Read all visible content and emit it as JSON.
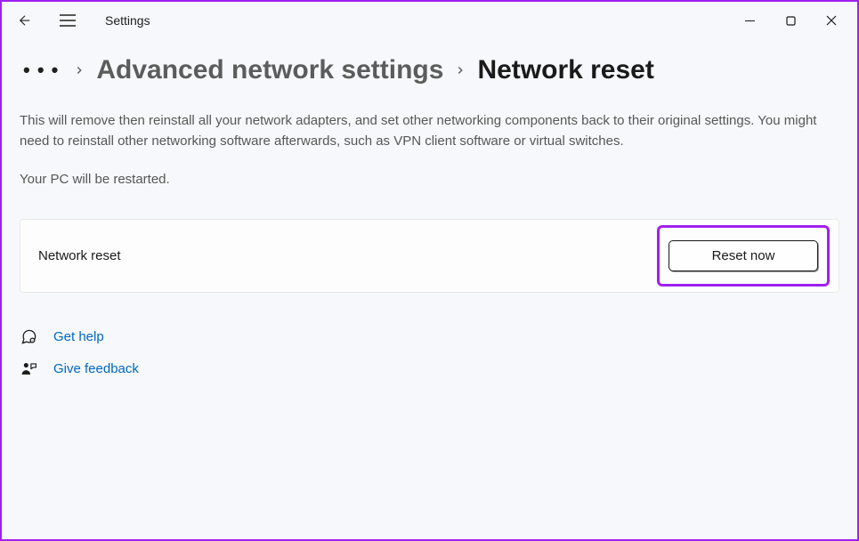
{
  "window": {
    "title": "Settings"
  },
  "breadcrumb": {
    "parent": "Advanced network settings",
    "current": "Network reset"
  },
  "main": {
    "description": "This will remove then reinstall all your network adapters, and set other networking components back to their original settings. You might need to reinstall other networking software afterwards, such as VPN client software or virtual switches.",
    "restartNote": "Your PC will be restarted.",
    "cardLabel": "Network reset",
    "resetButton": "Reset now"
  },
  "footer": {
    "help": "Get help",
    "feedback": "Give feedback"
  },
  "colors": {
    "accent": "#0067c0",
    "highlight": "#a020f0"
  }
}
